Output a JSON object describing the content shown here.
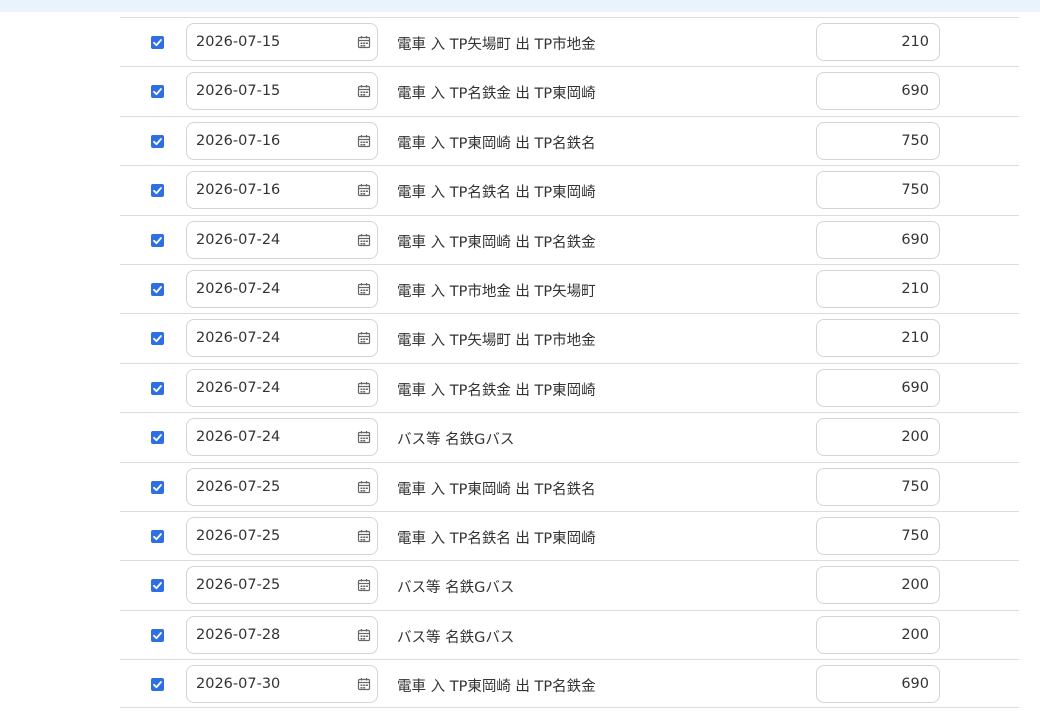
{
  "rows": [
    {
      "checked": true,
      "date": "2026-07-15",
      "description": "電車 入 TP矢場町 出 TP市地金",
      "amount": "210"
    },
    {
      "checked": true,
      "date": "2026-07-15",
      "description": "電車 入 TP名鉄金 出 TP東岡崎",
      "amount": "690"
    },
    {
      "checked": true,
      "date": "2026-07-16",
      "description": "電車 入 TP東岡崎 出 TP名鉄名",
      "amount": "750"
    },
    {
      "checked": true,
      "date": "2026-07-16",
      "description": "電車 入 TP名鉄名 出 TP東岡崎",
      "amount": "750"
    },
    {
      "checked": true,
      "date": "2026-07-24",
      "description": "電車 入 TP東岡崎 出 TP名鉄金",
      "amount": "690"
    },
    {
      "checked": true,
      "date": "2026-07-24",
      "description": "電車 入 TP市地金 出 TP矢場町",
      "amount": "210"
    },
    {
      "checked": true,
      "date": "2026-07-24",
      "description": "電車 入 TP矢場町 出 TP市地金",
      "amount": "210"
    },
    {
      "checked": true,
      "date": "2026-07-24",
      "description": "電車 入 TP名鉄金 出 TP東岡崎",
      "amount": "690"
    },
    {
      "checked": true,
      "date": "2026-07-24",
      "description": "バス等 名鉄Gバス",
      "amount": "200"
    },
    {
      "checked": true,
      "date": "2026-07-25",
      "description": "電車 入 TP東岡崎 出 TP名鉄名",
      "amount": "750"
    },
    {
      "checked": true,
      "date": "2026-07-25",
      "description": "電車 入 TP名鉄名 出 TP東岡崎",
      "amount": "750"
    },
    {
      "checked": true,
      "date": "2026-07-25",
      "description": "バス等 名鉄Gバス",
      "amount": "200"
    },
    {
      "checked": true,
      "date": "2026-07-28",
      "description": "バス等 名鉄Gバス",
      "amount": "200"
    },
    {
      "checked": true,
      "date": "2026-07-30",
      "description": "電車 入 TP東岡崎 出 TP名鉄金",
      "amount": "690"
    }
  ],
  "icons": {
    "checkbox": "checkmark-icon",
    "date_picker": "calendar-icon"
  },
  "colors": {
    "checkbox_accent": "#2f6fe4",
    "top_band": "#eaf2fd"
  }
}
